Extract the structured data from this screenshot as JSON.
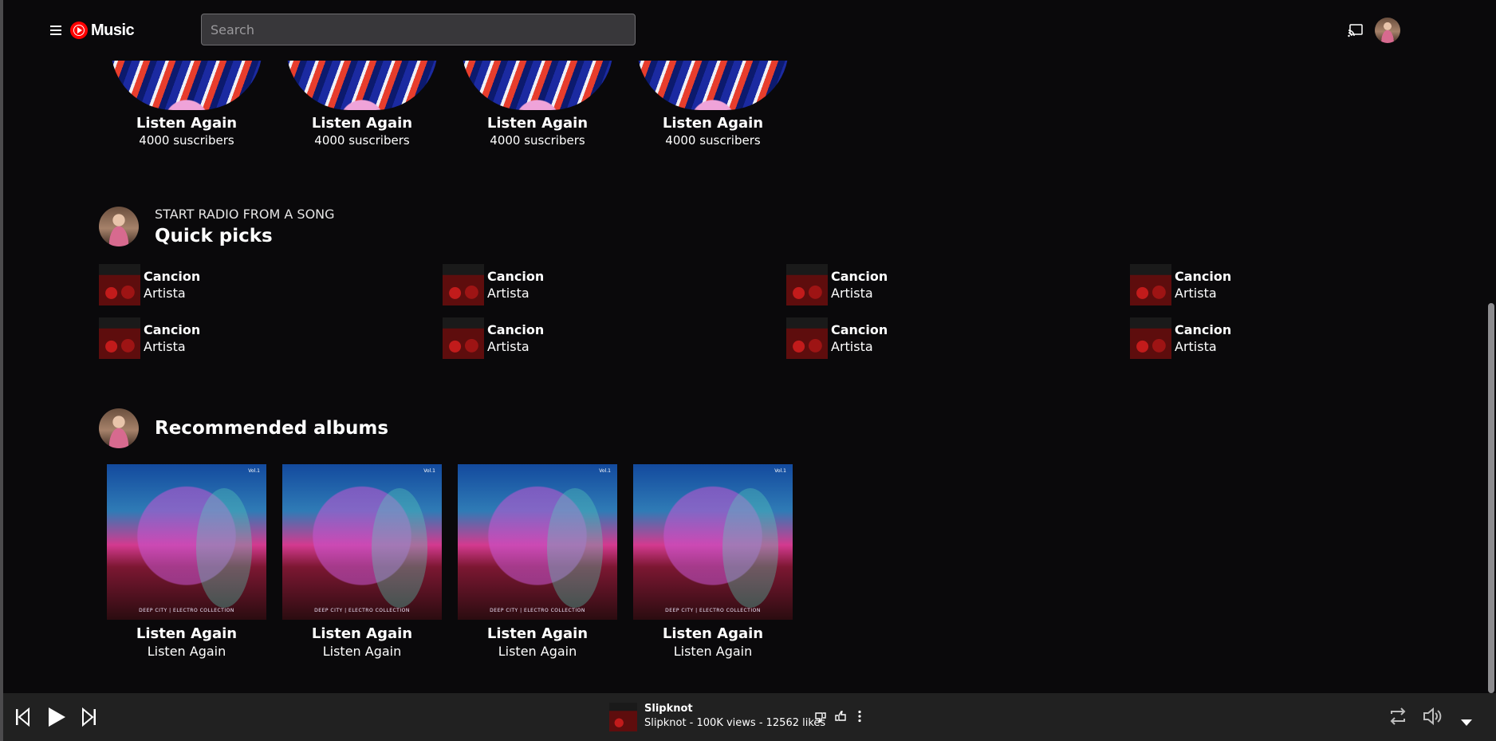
{
  "header": {
    "app_name": "Music",
    "search_placeholder": "Search"
  },
  "listen_again_top": [
    {
      "title": "Listen Again",
      "subtitle": "4000 suscribers"
    },
    {
      "title": "Listen Again",
      "subtitle": "4000 suscribers"
    },
    {
      "title": "Listen Again",
      "subtitle": "4000 suscribers"
    },
    {
      "title": "Listen Again",
      "subtitle": "4000 suscribers"
    }
  ],
  "quick_picks": {
    "kicker": "START RADIO FROM A SONG",
    "title": "Quick picks",
    "items": [
      {
        "title": "Cancion",
        "artist": "Artista"
      },
      {
        "title": "Cancion",
        "artist": "Artista"
      },
      {
        "title": "Cancion",
        "artist": "Artista"
      },
      {
        "title": "Cancion",
        "artist": "Artista"
      },
      {
        "title": "Cancion",
        "artist": "Artista"
      },
      {
        "title": "Cancion",
        "artist": "Artista"
      },
      {
        "title": "Cancion",
        "artist": "Artista"
      },
      {
        "title": "Cancion",
        "artist": "Artista"
      }
    ]
  },
  "recommended_albums": {
    "title": "Recommended albums",
    "cover_caption": "DEEP CITY | ELECTRO COLLECTION",
    "cover_volume": "Vol.1",
    "items": [
      {
        "title": "Listen Again",
        "subtitle": "Listen Again"
      },
      {
        "title": "Listen Again",
        "subtitle": "Listen Again"
      },
      {
        "title": "Listen Again",
        "subtitle": "Listen Again"
      },
      {
        "title": "Listen Again",
        "subtitle": "Listen Again"
      }
    ]
  },
  "player": {
    "track_title": "Slipknot",
    "track_meta": "Slipknot - 100K views - 12562 likes"
  },
  "icons": [
    "menu-icon",
    "cast-icon",
    "skip-previous-icon",
    "play-icon",
    "skip-next-icon",
    "thumbs-down-icon",
    "thumbs-up-icon",
    "more-vert-icon",
    "repeat-icon",
    "volume-icon",
    "expand-icon"
  ],
  "colors": {
    "background": "#0a090b",
    "player_bar": "#212121",
    "search_bg": "#38373a",
    "brand_red": "#ff0000"
  }
}
